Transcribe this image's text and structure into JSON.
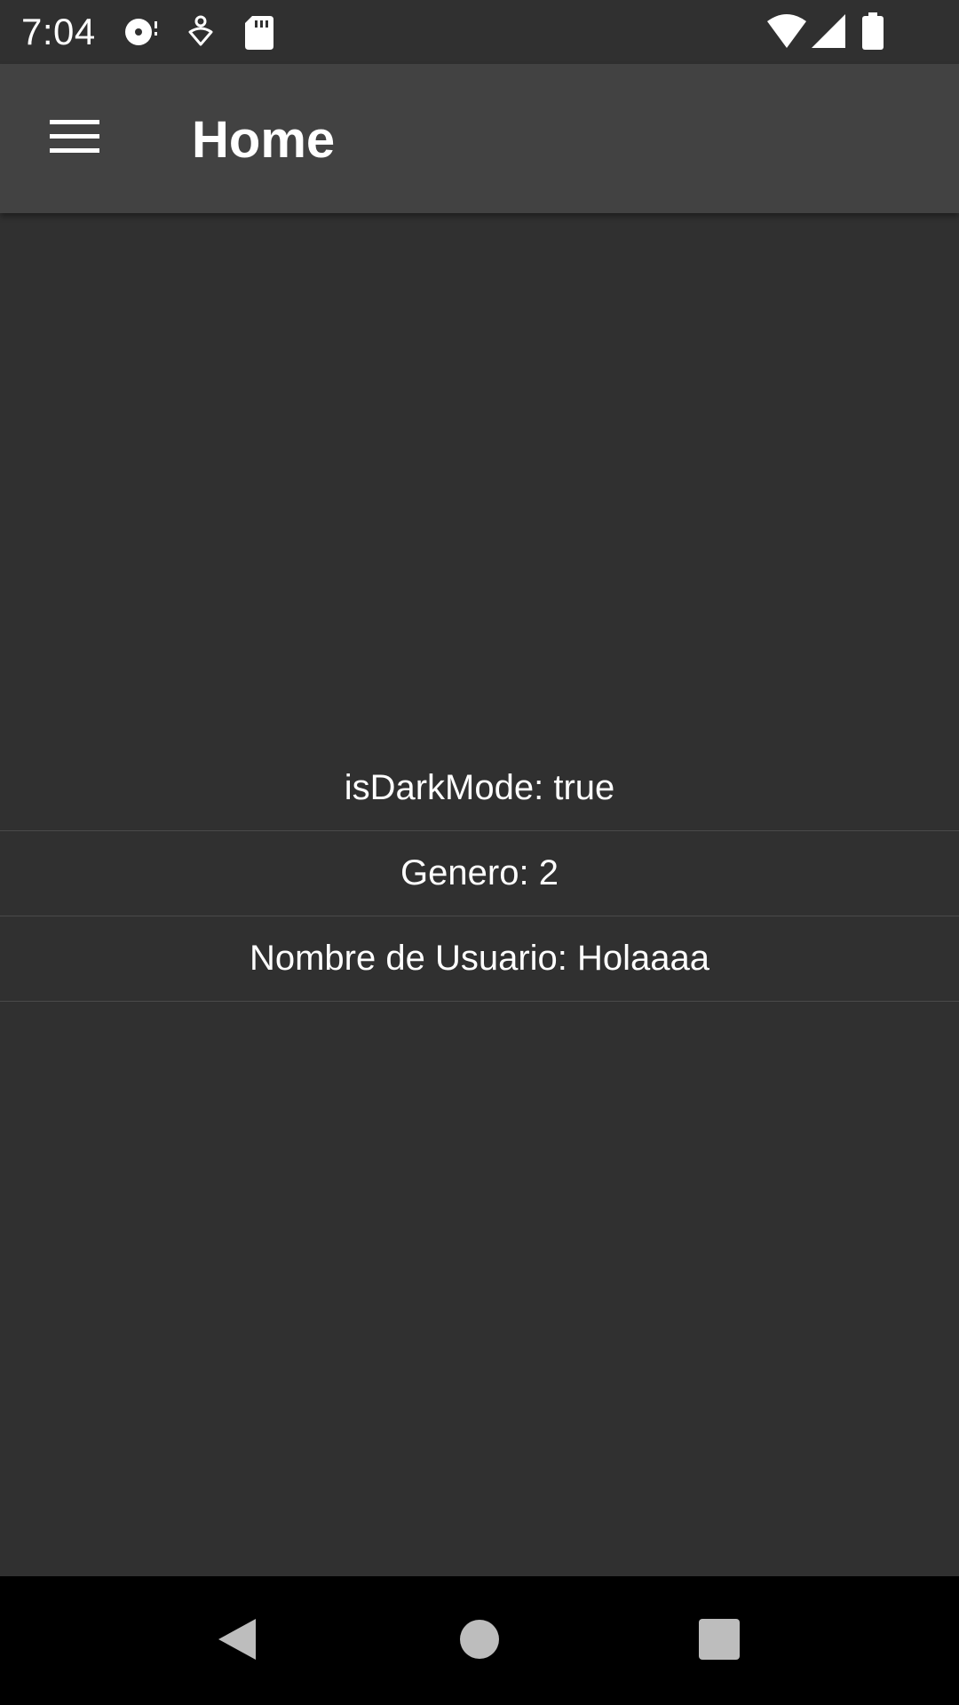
{
  "status_bar": {
    "time": "7:04",
    "left_icons": [
      "media-disc-icon",
      "pinned-location-icon",
      "sd-card-icon"
    ],
    "right_icons": [
      "wifi-icon",
      "cellular-signal-icon",
      "battery-icon"
    ]
  },
  "app_bar": {
    "title": "Home",
    "menu_icon": "hamburger-menu-icon"
  },
  "content": {
    "rows": [
      {
        "text": "isDarkMode: true"
      },
      {
        "text": "Genero: 2"
      },
      {
        "text": "Nombre de Usuario: Holaaaa"
      }
    ]
  },
  "nav_bar": {
    "buttons": [
      "back-icon",
      "home-icon",
      "recents-icon"
    ]
  },
  "colors": {
    "background": "#303030",
    "app_bar": "#424242",
    "nav_bar": "#000000",
    "text": "#ffffff"
  }
}
